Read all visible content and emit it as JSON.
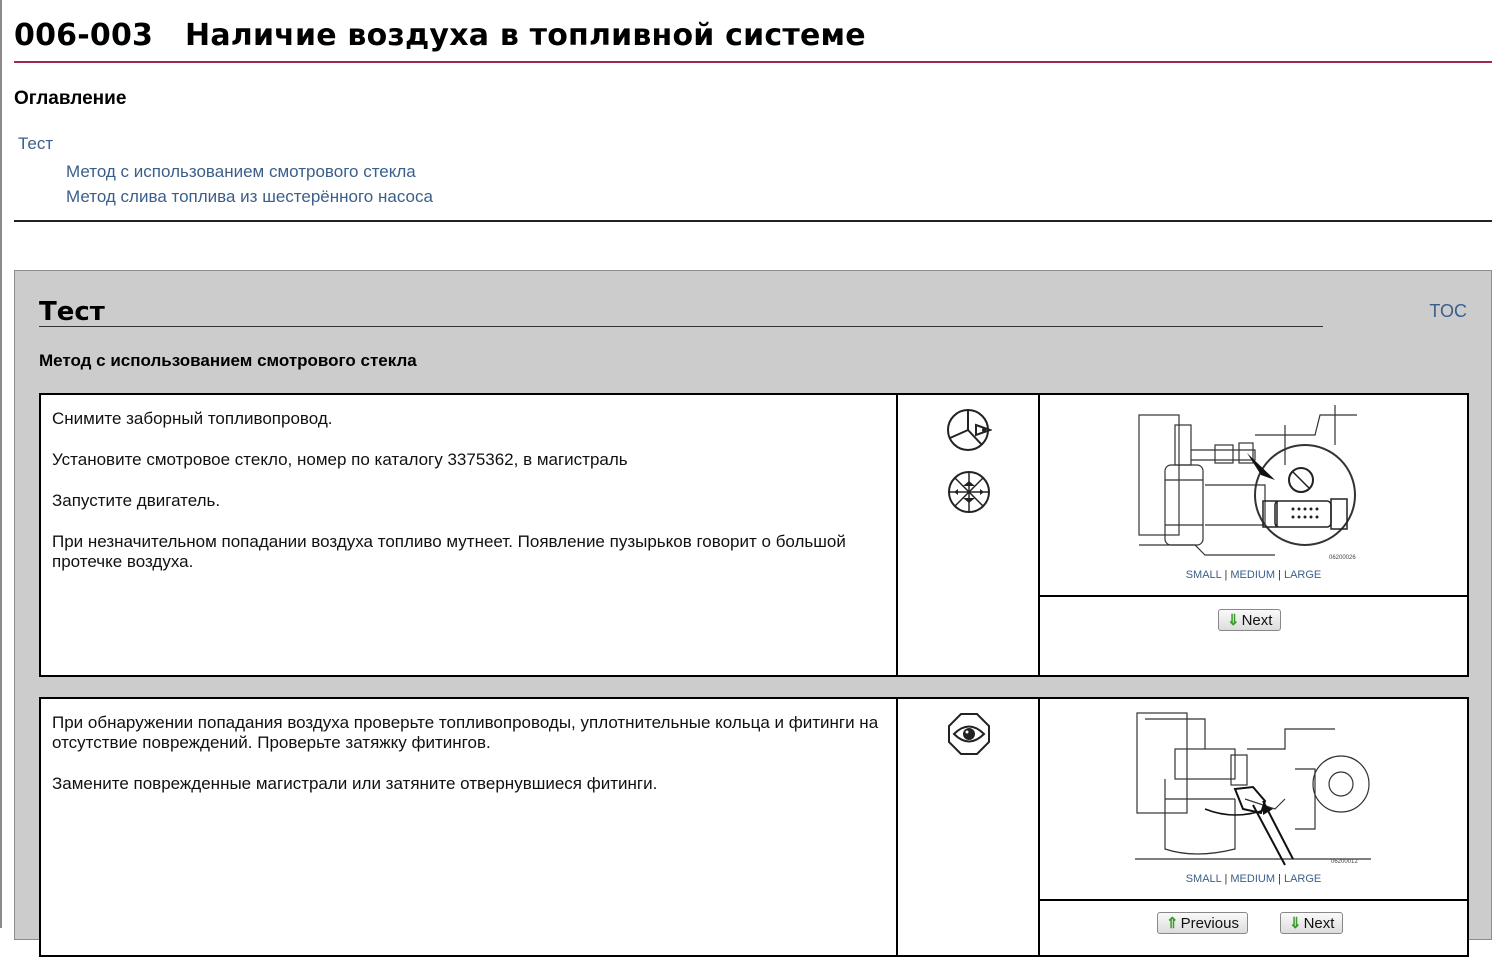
{
  "page": {
    "title": "006-003   Наличие воздуха в топливной системе"
  },
  "toc": {
    "heading": "Оглавление",
    "items": [
      {
        "label": "Тест"
      },
      {
        "label": "Метод с использованием смотрового стекла"
      },
      {
        "label": "Метод слива топлива из шестерённого насоса"
      }
    ]
  },
  "section": {
    "title": "Тест",
    "toc_link": "TOC",
    "method_title": "Метод с использованием смотрового стекла"
  },
  "steps": [
    {
      "paragraphs": [
        "Снимите заборный топливопровод.",
        "Установите смотровое стекло, номер по каталогу 3375362, в магистраль",
        "Запустите двигатель.",
        "При незначительном попадании воздуха топливо мутнеет. Появление пузырьков говорит о большой протечке воздуха."
      ],
      "icons": [
        "remove-component-icon",
        "install-component-icon"
      ],
      "image_code": "06200026",
      "size_links": {
        "small": "SMALL",
        "medium": "MEDIUM",
        "large": "LARGE",
        "sep": "|"
      },
      "next_label": "Next"
    },
    {
      "paragraphs": [
        "При обнаружении попадания воздуха проверьте топливопроводы, уплотнительные кольца и фитинги на отсутствие повреждений. Проверьте затяжку фитингов.",
        "Замените поврежденные магистрали или затяните отвернувшиеся фитинги."
      ],
      "icons": [
        "inspect-eye-icon"
      ],
      "image_code": "06200012",
      "size_links": {
        "small": "SMALL",
        "medium": "MEDIUM",
        "large": "LARGE",
        "sep": "|"
      },
      "previous_label": "Previous",
      "next_label": "Next"
    }
  ],
  "colors": {
    "link": "#3a5f8a",
    "title_rule": "#a0284a",
    "section_bg": "#cccccc",
    "button_arrow": "#3a9a2a"
  }
}
